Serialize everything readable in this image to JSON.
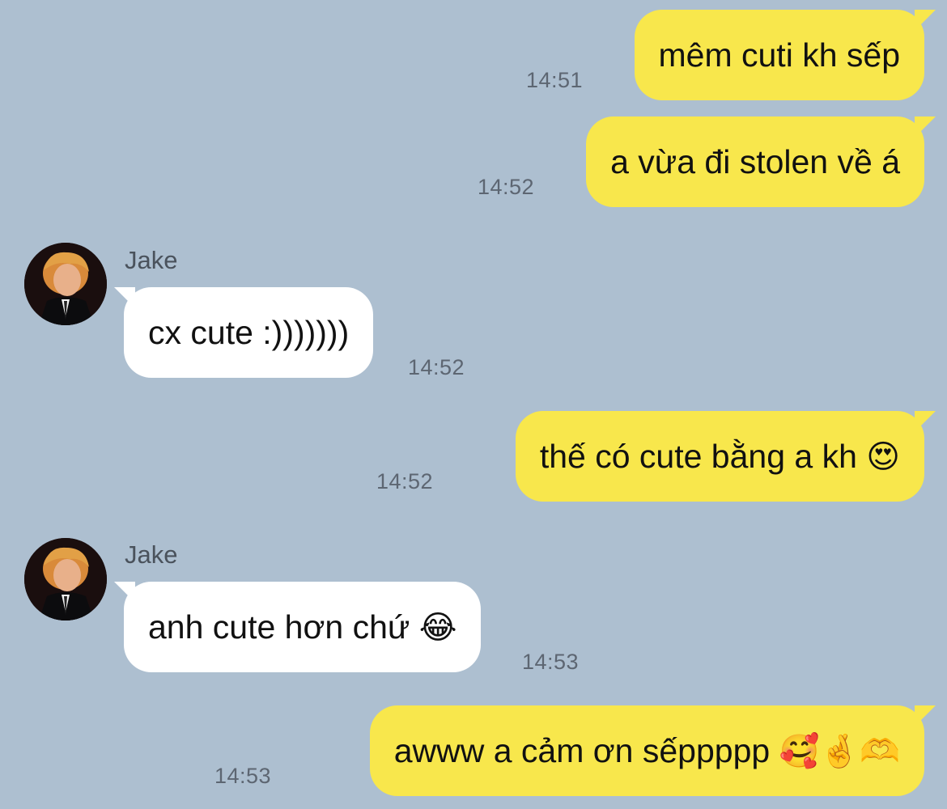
{
  "messages": [
    {
      "direction": "out",
      "text": "mêm cuti kh sếp",
      "time": "14:51"
    },
    {
      "direction": "out",
      "text": "a vừa đi stolen về á",
      "time": "14:52"
    },
    {
      "direction": "in",
      "sender": "Jake",
      "text": "cx cute :)))))))",
      "time": "14:52"
    },
    {
      "direction": "out",
      "text": "thế có cute bằng a kh",
      "emoji": "😍",
      "time": "14:52"
    },
    {
      "direction": "in",
      "sender": "Jake",
      "text": "anh cute hơn chứ",
      "emoji": "😂",
      "time": "14:53"
    },
    {
      "direction": "out",
      "text": "awww a cảm ơn sếppppp",
      "emoji": "🥰🤞🫶",
      "time": "14:53"
    }
  ],
  "colors": {
    "background": "#adbfd0",
    "outgoing_bubble": "#f8e74c",
    "incoming_bubble": "#ffffff",
    "timestamp": "#5d6672"
  }
}
